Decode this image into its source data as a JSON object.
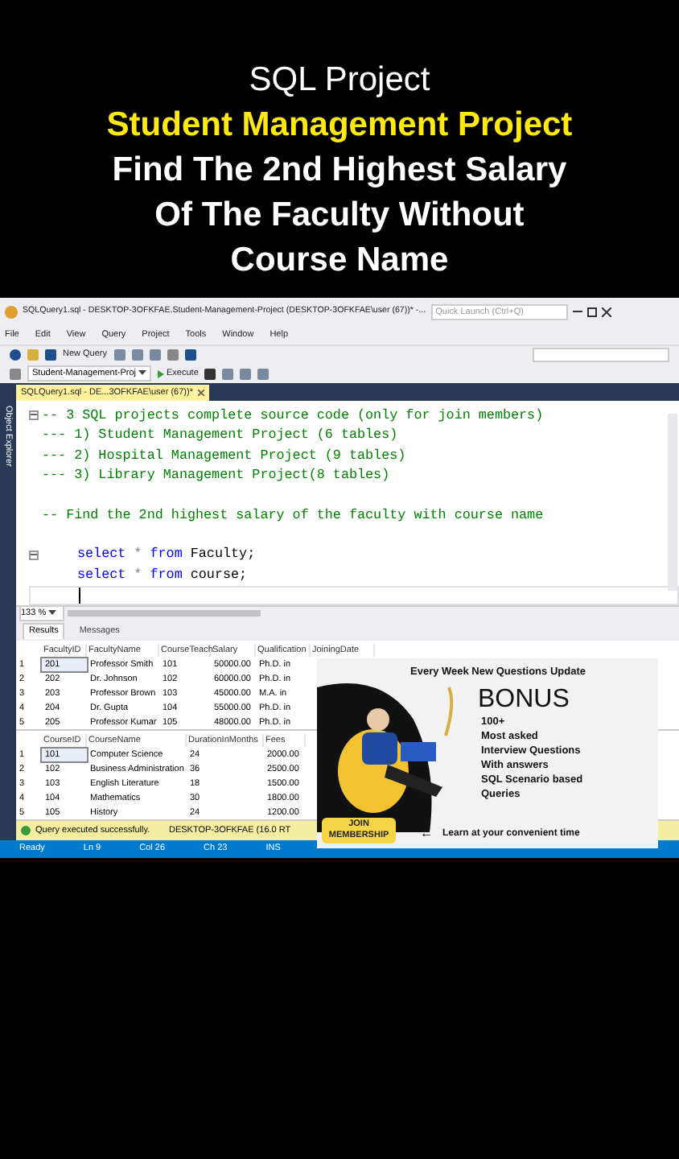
{
  "headline": {
    "subtitle": "SQL Project",
    "highlight": "Student Management Project",
    "lines": [
      "Find The 2nd Highest Salary",
      "Of The Faculty Without",
      "Course Name"
    ]
  },
  "window": {
    "title": "SQLQuery1.sql - DESKTOP-3OFKFAE.Student-Management-Project (DESKTOP-3OFKFAE\\user (67))* -...",
    "quick_launch": {
      "placeholder": "Quick Launch (Ctrl+Q)"
    }
  },
  "menu": [
    "File",
    "Edit",
    "View",
    "Query",
    "Project",
    "Tools",
    "Window",
    "Help"
  ],
  "toolbar": {
    "new_query": "New Query",
    "database": "Student-Management-Proj",
    "execute": "Execute"
  },
  "side_panel": "Object Explorer",
  "tabs": [
    {
      "label": "SQLQuery1.sql - DE...3OFKFAE\\user (67))*",
      "selected": true
    }
  ],
  "editor": {
    "lines": [
      {
        "kind": "comment",
        "fold": true,
        "text": "-- 3 SQL projects complete source code (only for join members)"
      },
      {
        "kind": "comment",
        "fold": false,
        "text": "--- 1) Student Management Project (6 tables)"
      },
      {
        "kind": "comment",
        "fold": false,
        "text": "--- 2) Hospital Management Project (9 tables)"
      },
      {
        "kind": "comment",
        "fold": false,
        "text": "--- 3) Library Management Project(8 tables)"
      },
      {
        "kind": "blank"
      },
      {
        "kind": "comment",
        "fold": false,
        "text": "-- Find the 2nd highest salary of the faculty with course name"
      },
      {
        "kind": "blank"
      },
      {
        "kind": "code",
        "fold": true,
        "tokens": [
          {
            "kind": "keyword",
            "text": "select"
          },
          {
            "kind": "operator",
            "text": "*"
          },
          {
            "kind": "keyword",
            "text": "from"
          },
          {
            "kind": "plain",
            "text": "Faculty;"
          }
        ]
      },
      {
        "kind": "code",
        "fold": false,
        "tokens": [
          {
            "kind": "keyword",
            "text": "select"
          },
          {
            "kind": "operator",
            "text": "*"
          },
          {
            "kind": "keyword",
            "text": "from"
          },
          {
            "kind": "plain",
            "text": "course;"
          }
        ]
      },
      {
        "kind": "cursor"
      }
    ]
  },
  "zoom": "133 %",
  "results_tabs": [
    {
      "label": "Results",
      "selected": true
    },
    {
      "label": "Messages",
      "selected": false
    }
  ],
  "grids": [
    {
      "columns": [
        "FacultyID",
        "FacultyName",
        "CourseTeach",
        "Salary",
        "Qualification",
        "JoiningDate"
      ],
      "rows": [
        {
          "number": "1",
          "focused": true,
          "cells": [
            "201",
            "Professor Smith",
            "101",
            "50000.00",
            "Ph.D. in"
          ]
        },
        {
          "number": "2",
          "focused": false,
          "cells": [
            "202",
            "Dr. Johnson",
            "102",
            "60000.00",
            "Ph.D. in"
          ]
        },
        {
          "number": "3",
          "focused": false,
          "cells": [
            "203",
            "Professor Brown",
            "103",
            "45000.00",
            "M.A. in"
          ]
        },
        {
          "number": "4",
          "focused": false,
          "cells": [
            "204",
            "Dr. Gupta",
            "104",
            "55000.00",
            "Ph.D. in"
          ]
        },
        {
          "number": "5",
          "focused": false,
          "cells": [
            "205",
            "Professor Kumar",
            "105",
            "48000.00",
            "Ph.D. in"
          ]
        }
      ]
    },
    {
      "columns": [
        "CourseID",
        "CourseName",
        "DurationInMonths",
        "Fees"
      ],
      "rows": [
        {
          "number": "1",
          "focused": true,
          "cells": [
            "101",
            "Computer Science",
            "24",
            "2000.00"
          ]
        },
        {
          "number": "2",
          "focused": false,
          "cells": [
            "102",
            "Business Administration",
            "36",
            "2500.00"
          ]
        },
        {
          "number": "3",
          "focused": false,
          "cells": [
            "103",
            "English Literature",
            "18",
            "1500.00"
          ]
        },
        {
          "number": "4",
          "focused": false,
          "cells": [
            "104",
            "Mathematics",
            "30",
            "1800.00"
          ]
        },
        {
          "number": "5",
          "focused": false,
          "cells": [
            "105",
            "History",
            "24",
            "1200.00"
          ]
        }
      ]
    }
  ],
  "query_status": {
    "message": "Query executed successfully.",
    "server": "DESKTOP-3OFKFAE (16.0 RT"
  },
  "status_bar": [
    "Ready",
    "Ln 9",
    "Col 26",
    "Ch 23",
    "INS"
  ],
  "ad": {
    "heading": "Every Week New Questions Update",
    "bonus": "BONUS",
    "lines": [
      "100+",
      "Most asked",
      "Interview Questions",
      "With answers",
      "SQL Scenario based",
      "Queries"
    ],
    "button": "JOIN MEMBERSHIP",
    "arrow": "←",
    "footer": "Learn at your convenient time"
  }
}
